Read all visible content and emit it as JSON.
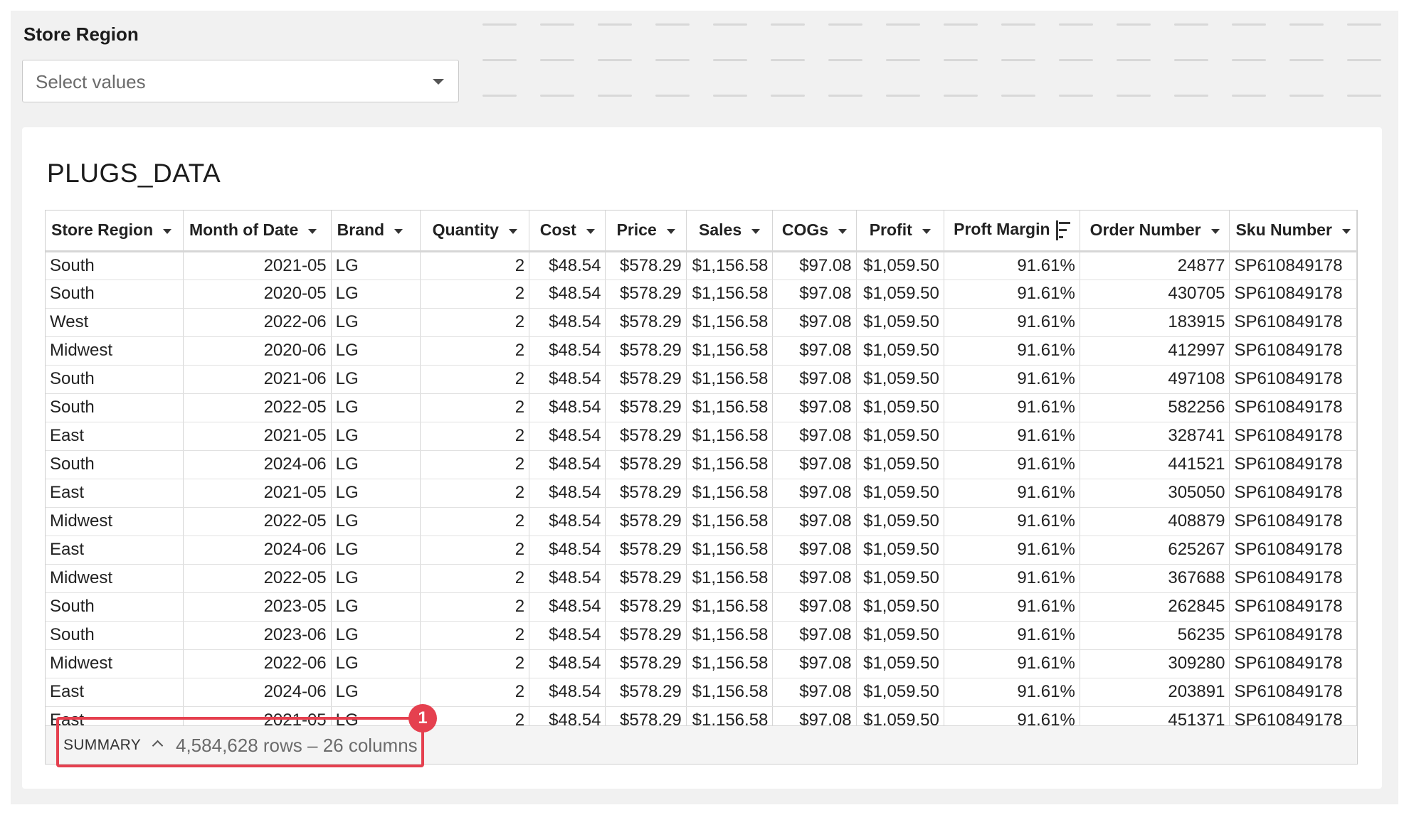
{
  "filter": {
    "label": "Store Region",
    "placeholder": "Select values"
  },
  "table": {
    "title": "PLUGS_DATA",
    "columns": [
      {
        "label": "Store Region",
        "align": "l"
      },
      {
        "label": "Month of Date",
        "align": "r"
      },
      {
        "label": "Brand",
        "align": "l"
      },
      {
        "label": "Quantity",
        "align": "r"
      },
      {
        "label": "Cost",
        "align": "r"
      },
      {
        "label": "Price",
        "align": "r"
      },
      {
        "label": "Sales",
        "align": "r"
      },
      {
        "label": "COGs",
        "align": "r"
      },
      {
        "label": "Profit",
        "align": "r"
      },
      {
        "label": "Proft Margin",
        "align": "r",
        "sorted": true
      },
      {
        "label": "Order Number",
        "align": "r"
      },
      {
        "label": "Sku Number",
        "align": "l"
      }
    ],
    "rows": [
      [
        "South",
        "2021-05",
        "LG",
        "2",
        "$48.54",
        "$578.29",
        "$1,156.58",
        "$97.08",
        "$1,059.50",
        "91.61%",
        "24877",
        "SP610849178"
      ],
      [
        "South",
        "2020-05",
        "LG",
        "2",
        "$48.54",
        "$578.29",
        "$1,156.58",
        "$97.08",
        "$1,059.50",
        "91.61%",
        "430705",
        "SP610849178"
      ],
      [
        "West",
        "2022-06",
        "LG",
        "2",
        "$48.54",
        "$578.29",
        "$1,156.58",
        "$97.08",
        "$1,059.50",
        "91.61%",
        "183915",
        "SP610849178"
      ],
      [
        "Midwest",
        "2020-06",
        "LG",
        "2",
        "$48.54",
        "$578.29",
        "$1,156.58",
        "$97.08",
        "$1,059.50",
        "91.61%",
        "412997",
        "SP610849178"
      ],
      [
        "South",
        "2021-06",
        "LG",
        "2",
        "$48.54",
        "$578.29",
        "$1,156.58",
        "$97.08",
        "$1,059.50",
        "91.61%",
        "497108",
        "SP610849178"
      ],
      [
        "South",
        "2022-05",
        "LG",
        "2",
        "$48.54",
        "$578.29",
        "$1,156.58",
        "$97.08",
        "$1,059.50",
        "91.61%",
        "582256",
        "SP610849178"
      ],
      [
        "East",
        "2021-05",
        "LG",
        "2",
        "$48.54",
        "$578.29",
        "$1,156.58",
        "$97.08",
        "$1,059.50",
        "91.61%",
        "328741",
        "SP610849178"
      ],
      [
        "South",
        "2024-06",
        "LG",
        "2",
        "$48.54",
        "$578.29",
        "$1,156.58",
        "$97.08",
        "$1,059.50",
        "91.61%",
        "441521",
        "SP610849178"
      ],
      [
        "East",
        "2021-05",
        "LG",
        "2",
        "$48.54",
        "$578.29",
        "$1,156.58",
        "$97.08",
        "$1,059.50",
        "91.61%",
        "305050",
        "SP610849178"
      ],
      [
        "Midwest",
        "2022-05",
        "LG",
        "2",
        "$48.54",
        "$578.29",
        "$1,156.58",
        "$97.08",
        "$1,059.50",
        "91.61%",
        "408879",
        "SP610849178"
      ],
      [
        "East",
        "2024-06",
        "LG",
        "2",
        "$48.54",
        "$578.29",
        "$1,156.58",
        "$97.08",
        "$1,059.50",
        "91.61%",
        "625267",
        "SP610849178"
      ],
      [
        "Midwest",
        "2022-05",
        "LG",
        "2",
        "$48.54",
        "$578.29",
        "$1,156.58",
        "$97.08",
        "$1,059.50",
        "91.61%",
        "367688",
        "SP610849178"
      ],
      [
        "South",
        "2023-05",
        "LG",
        "2",
        "$48.54",
        "$578.29",
        "$1,156.58",
        "$97.08",
        "$1,059.50",
        "91.61%",
        "262845",
        "SP610849178"
      ],
      [
        "South",
        "2023-06",
        "LG",
        "2",
        "$48.54",
        "$578.29",
        "$1,156.58",
        "$97.08",
        "$1,059.50",
        "91.61%",
        "56235",
        "SP610849178"
      ],
      [
        "Midwest",
        "2022-06",
        "LG",
        "2",
        "$48.54",
        "$578.29",
        "$1,156.58",
        "$97.08",
        "$1,059.50",
        "91.61%",
        "309280",
        "SP610849178"
      ],
      [
        "East",
        "2024-06",
        "LG",
        "2",
        "$48.54",
        "$578.29",
        "$1,156.58",
        "$97.08",
        "$1,059.50",
        "91.61%",
        "203891",
        "SP610849178"
      ],
      [
        "East",
        "2021-05",
        "LG",
        "2",
        "$48.54",
        "$578.29",
        "$1,156.58",
        "$97.08",
        "$1,059.50",
        "91.61%",
        "451371",
        "SP610849178"
      ]
    ]
  },
  "summary": {
    "label": "SUMMARY",
    "counts": "4,584,628 rows – 26 columns"
  },
  "annotation": {
    "badge": "1",
    "color": "#e5404f"
  }
}
